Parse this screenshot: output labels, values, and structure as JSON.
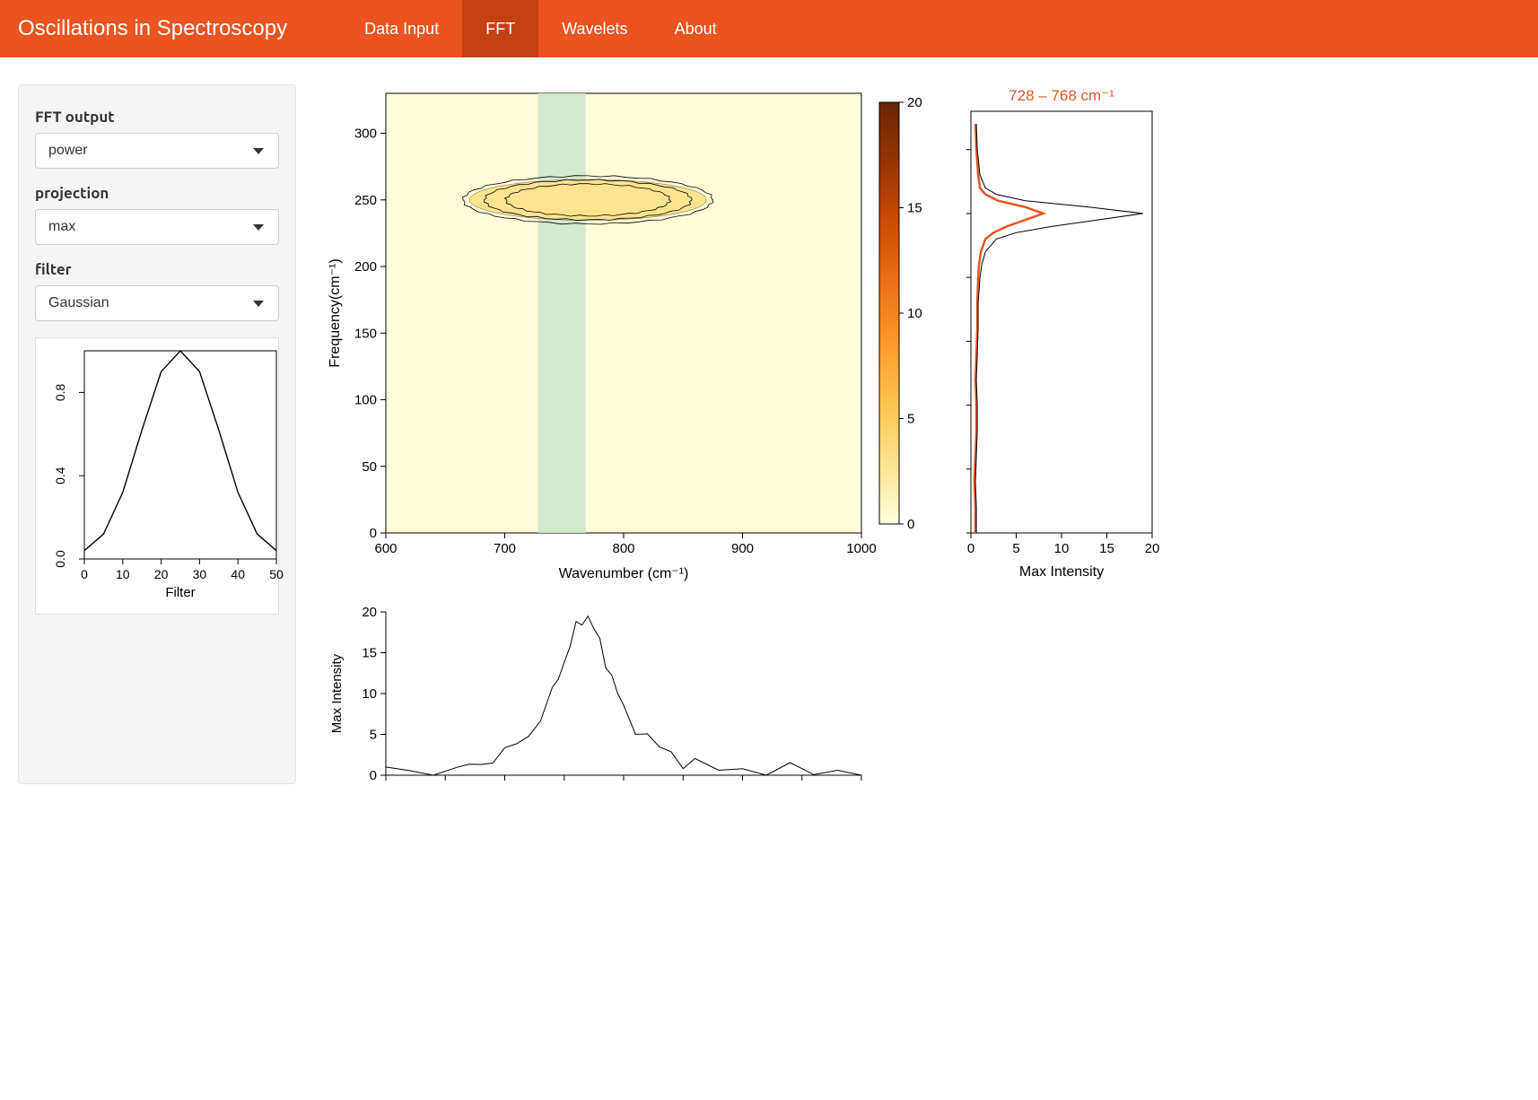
{
  "app": {
    "title": "Oscillations in Spectroscopy"
  },
  "nav": {
    "tabs": [
      "Data Input",
      "FFT",
      "Wavelets",
      "About"
    ],
    "active_index": 1
  },
  "sidebar": {
    "fft_output": {
      "label": "FFT output",
      "value": "power"
    },
    "projection": {
      "label": "projection",
      "value": "max"
    },
    "filter": {
      "label": "filter",
      "value": "Gaussian"
    },
    "filter_plot": {
      "xlabel": "Filter",
      "x_ticks": [
        0,
        10,
        20,
        30,
        40,
        50
      ],
      "y_ticks": [
        0.0,
        0.4,
        0.8
      ]
    }
  },
  "chart_data": [
    {
      "type": "heatmap",
      "name": "fft_map",
      "xlabel": "Wavenumber (cm⁻¹)",
      "ylabel": "Frequency(cm⁻¹)",
      "xlim": [
        600,
        1000
      ],
      "ylim": [
        0,
        330
      ],
      "x_ticks": [
        600,
        700,
        800,
        900,
        1000
      ],
      "y_ticks": [
        0,
        50,
        100,
        150,
        200,
        250,
        300
      ],
      "selection_band": [
        728,
        768
      ],
      "colorbar": {
        "ticks": [
          0,
          5,
          10,
          15,
          20
        ],
        "colors": [
          "#FFFFE0",
          "#FEE391",
          "#FEC44F",
          "#FE9929",
          "#EC7014",
          "#CC4C02",
          "#993404",
          "#662506"
        ]
      },
      "hotspot": {
        "center_x": 770,
        "center_y": 250,
        "x_extent": [
          660,
          860
        ],
        "y_extent": [
          235,
          265
        ],
        "peak_value": 20
      }
    },
    {
      "type": "line",
      "name": "right_projection",
      "title": "728 – 768 cm⁻¹",
      "xlabel": "Max Intensity",
      "xlim": [
        0,
        20
      ],
      "ylim": [
        0,
        330
      ],
      "x_ticks": [
        0,
        5,
        10,
        15,
        20
      ],
      "series": [
        {
          "name": "selection",
          "color": "#e95420",
          "y": [
            0,
            20,
            40,
            60,
            80,
            100,
            120,
            140,
            160,
            180,
            200,
            210,
            220,
            230,
            235,
            240,
            245,
            250,
            255,
            260,
            265,
            270,
            280,
            300,
            320
          ],
          "x": [
            0.5,
            0.5,
            0.4,
            0.5,
            0.6,
            0.6,
            0.5,
            0.6,
            0.7,
            0.7,
            0.8,
            0.9,
            1.1,
            1.6,
            2.5,
            4.0,
            6.0,
            8.0,
            6.0,
            3.0,
            1.6,
            1.0,
            0.8,
            0.6,
            0.5
          ]
        },
        {
          "name": "global",
          "color": "#000000",
          "y": [
            0,
            20,
            40,
            60,
            80,
            100,
            120,
            140,
            160,
            180,
            200,
            210,
            220,
            230,
            235,
            240,
            245,
            250,
            255,
            260,
            265,
            270,
            280,
            300,
            320
          ],
          "x": [
            0.6,
            0.6,
            0.5,
            0.6,
            0.7,
            0.7,
            0.6,
            0.7,
            0.8,
            0.8,
            1.0,
            1.2,
            1.6,
            2.8,
            5.0,
            9.0,
            14.0,
            19.0,
            13.0,
            6.0,
            2.8,
            1.6,
            1.0,
            0.7,
            0.6
          ]
        }
      ]
    },
    {
      "type": "line",
      "name": "bottom_projection",
      "ylabel": "Max Intensity",
      "xlim": [
        600,
        1000
      ],
      "ylim": [
        0,
        20
      ],
      "y_ticks": [
        0,
        5,
        10,
        15,
        20
      ],
      "series": [
        {
          "name": "max",
          "color": "#000000",
          "x": [
            600,
            620,
            640,
            660,
            670,
            680,
            690,
            700,
            710,
            720,
            730,
            740,
            745,
            750,
            755,
            760,
            765,
            770,
            775,
            780,
            785,
            790,
            795,
            800,
            810,
            820,
            830,
            840,
            850,
            860,
            880,
            900,
            920,
            940,
            960,
            980,
            1000
          ],
          "values": [
            0.5,
            0.6,
            0.5,
            0.7,
            1.0,
            1.5,
            2.0,
            2.8,
            3.8,
            5.0,
            7.0,
            10.0,
            12.0,
            14.0,
            16.0,
            18.0,
            19.0,
            19.5,
            18.0,
            16.0,
            14.0,
            12.0,
            10.0,
            8.0,
            6.0,
            4.5,
            3.5,
            2.5,
            1.8,
            1.2,
            0.8,
            0.6,
            0.5,
            0.5,
            0.5,
            0.5,
            0.5
          ]
        }
      ]
    },
    {
      "type": "line",
      "name": "filter_shape",
      "xlabel": "Filter",
      "xlim": [
        0,
        50
      ],
      "ylim": [
        0,
        1
      ],
      "x": [
        0,
        5,
        10,
        15,
        20,
        25,
        30,
        35,
        40,
        45,
        50
      ],
      "values": [
        0.04,
        0.12,
        0.32,
        0.62,
        0.9,
        1.0,
        0.9,
        0.62,
        0.32,
        0.12,
        0.04
      ]
    }
  ]
}
